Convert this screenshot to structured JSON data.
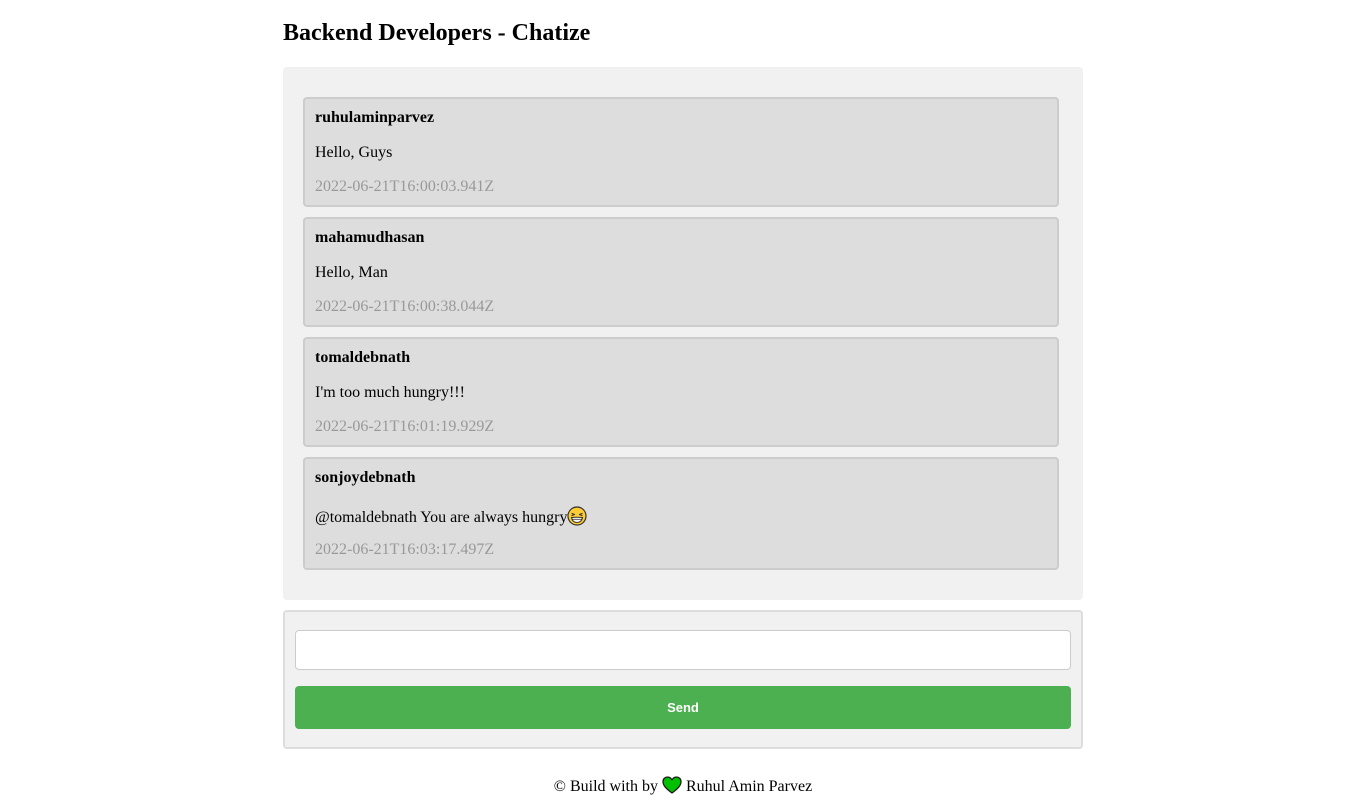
{
  "page": {
    "title": "Backend Developers - Chatize"
  },
  "messages": [
    {
      "user": "ruhulaminparvez",
      "text": "Hello, Guys",
      "time": "2022-06-21T16:00:03.941Z"
    },
    {
      "user": "mahamudhasan",
      "text": "Hello, Man",
      "time": "2022-06-21T16:00:38.044Z"
    },
    {
      "user": "tomaldebnath",
      "text": "I'm too much hungry!!!",
      "time": "2022-06-21T16:01:19.929Z"
    },
    {
      "user": "sonjoydebnath",
      "text": "@tomaldebnath You are always hungry",
      "emoji": "laughing-face-emoji",
      "time": "2022-06-21T16:03:17.497Z"
    }
  ],
  "compose": {
    "input_value": "",
    "input_placeholder": "",
    "send_label": "Send"
  },
  "footer": {
    "prefix": "© Build with by",
    "icon": "green-heart-icon",
    "author": "Ruhul Amin Parvez"
  },
  "colors": {
    "accent": "#4caf50",
    "heart": "#00c000",
    "message_bg": "#dddddd",
    "panel_bg": "#f1f1f1",
    "timestamp": "#999999"
  }
}
